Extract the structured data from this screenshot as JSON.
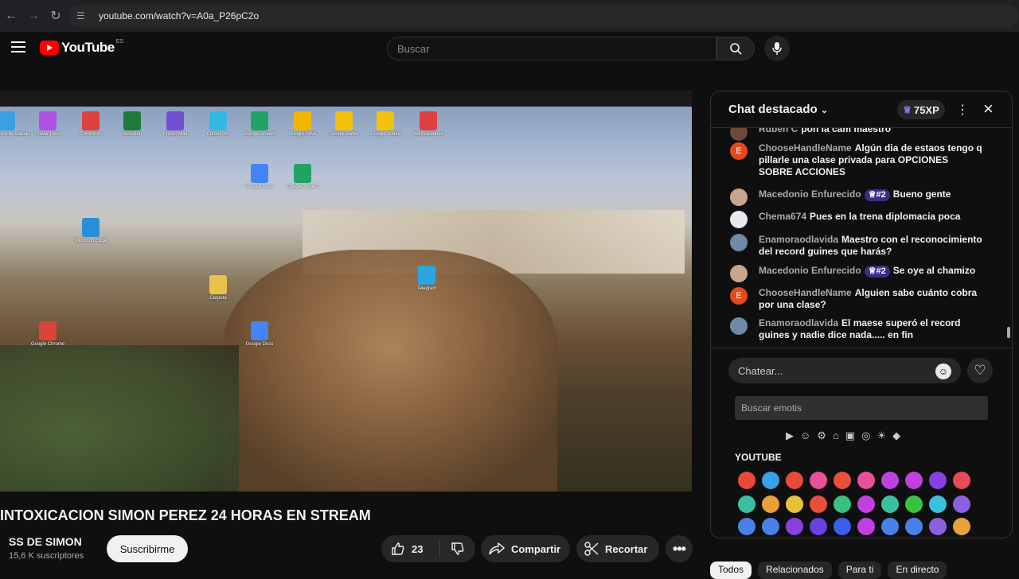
{
  "browser": {
    "url": "youtube.com/watch?v=A0a_P26pC2o",
    "back_icon": "arrow-left-icon",
    "forward_icon": "arrow-right-icon",
    "reload_icon": "reload-icon"
  },
  "header": {
    "logo_text": "YouTube",
    "country_code": "ES",
    "search_placeholder": "Buscar"
  },
  "video": {
    "title": "INTOXICACION SIMON PEREZ 24 HORAS EN STREAM",
    "desktop_icons": [
      {
        "label": "Documento de trabajo",
        "color": "#3aa0e0"
      },
      {
        "label": "Power Pass",
        "color": "#b050e0"
      },
      {
        "label": "Chromium",
        "color": "#e04040"
      },
      {
        "label": "conexion",
        "color": "#1f7a3a"
      },
      {
        "label": "Proton Mail",
        "color": "#7050d0"
      },
      {
        "label": "Cursor Pro",
        "color": "#35b8e0"
      },
      {
        "label": "Google Sheets",
        "color": "#21a366"
      },
      {
        "label": "Google Drive",
        "color": "#f4b400"
      },
      {
        "label": "Google Slides",
        "color": "#f4c20d"
      },
      {
        "label": "Google Slides",
        "color": "#f4c20d"
      },
      {
        "label": "Notificaciones",
        "color": "#e04040"
      },
      {
        "label": "Google Docs",
        "color": "#4285f4"
      },
      {
        "label": "Google Sheets",
        "color": "#21a366"
      },
      {
        "label": "Microsoft Edge",
        "color": "#2a8fd6"
      },
      {
        "label": "Telegram",
        "color": "#2ca5e0"
      },
      {
        "label": "Google Chrome",
        "color": "#db4437"
      },
      {
        "label": "Carpeta",
        "color": "#e8c34a"
      },
      {
        "label": "Google Docs",
        "color": "#4285f4"
      }
    ]
  },
  "channel": {
    "name": "SS DE SIMON",
    "subscribers": "15,6 K suscriptores",
    "subscribe_label": "Suscribirme"
  },
  "actions": {
    "likes": "23",
    "share_label": "Compartir",
    "clip_label": "Recortar"
  },
  "chat": {
    "title": "Chat destacado",
    "xp": "75XP",
    "messages": [
      {
        "author": "Ruben C",
        "text": "pon la cam maestro",
        "avatar_color": "#6a4a3a"
      },
      {
        "author": "ChooseHandleName",
        "text": "Algún dia de estaos tengo q pillarle una clase privada para OPCIONES SOBRE ACCIONES",
        "avatar_color": "#e64a19",
        "initial": "E"
      },
      {
        "author": "Macedonio Enfurecido",
        "badge": "#2",
        "text": "Bueno gente",
        "avatar_color": "#c9a58c"
      },
      {
        "author": "Chema674",
        "text": "Pues en la trena diplomacia poca",
        "avatar_color": "#e8e8f0"
      },
      {
        "author": "Enamoraodlavida",
        "text": "Maestro con el reconocimiento del record guines que harás?",
        "avatar_color": "#6e8aa6"
      },
      {
        "author": "Macedonio Enfurecido",
        "badge": "#2",
        "text": "Se oye al chamizo",
        "avatar_color": "#c9a58c"
      },
      {
        "author": "ChooseHandleName",
        "text": "Alguien sabe cuánto cobra por una clase?",
        "avatar_color": "#e64a19",
        "initial": "E"
      },
      {
        "author": "Enamoraodlavida",
        "text": "El maese superó el record guines y nadie dice nada..... en fin",
        "avatar_color": "#6e8aa6"
      }
    ],
    "input_placeholder": "Chatear...",
    "emoji_search_placeholder": "Buscar emotis",
    "emoji_section": "YOUTUBE",
    "emoji_categories": [
      "youtube-icon",
      "smiley-icon",
      "gear-icon",
      "building-icon",
      "car-icon",
      "basketball-icon",
      "lightbulb-icon",
      "diamond-icon"
    ]
  },
  "bottom_tabs": [
    "Todos",
    "Relacionados",
    "Para ti",
    "En directo"
  ],
  "colors": {
    "yt_red": "#ff0000",
    "background": "#0f0f0f",
    "badge": "#3d2a8a"
  }
}
